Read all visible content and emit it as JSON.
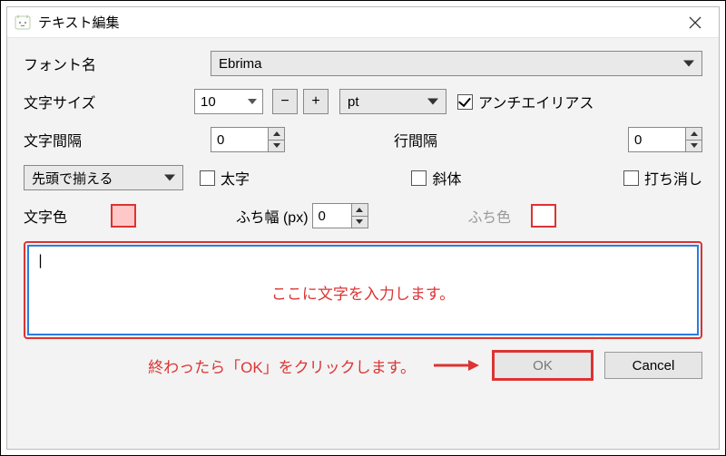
{
  "titlebar": {
    "title": "テキスト編集"
  },
  "labels": {
    "font_name": "フォント名",
    "font_size": "文字サイズ",
    "char_spacing": "文字間隔",
    "line_spacing": "行間隔",
    "text_color": "文字色",
    "outline_width": "ふち幅 (px)",
    "outline_color": "ふち色"
  },
  "font": {
    "selected": "Ebrima"
  },
  "size": {
    "value": "10",
    "minus": "−",
    "plus": "+",
    "unit": "pt"
  },
  "antialias": {
    "label": "アンチエイリアス",
    "checked": true
  },
  "char_spacing_value": "0",
  "line_spacing_value": "0",
  "align": {
    "selected": "先頭で揃える"
  },
  "styles": {
    "bold_label": "太字",
    "italic_label": "斜体",
    "strike_label": "打ち消し"
  },
  "outline_width_value": "0",
  "colors": {
    "text_color": "#ffc8c8",
    "outline_color": "#ffffff"
  },
  "textarea": {
    "content": "|",
    "hint": "ここに文字を入力します。"
  },
  "bottom": {
    "hint": "終わったら「OK」をクリックします。",
    "ok": "OK",
    "cancel": "Cancel"
  }
}
